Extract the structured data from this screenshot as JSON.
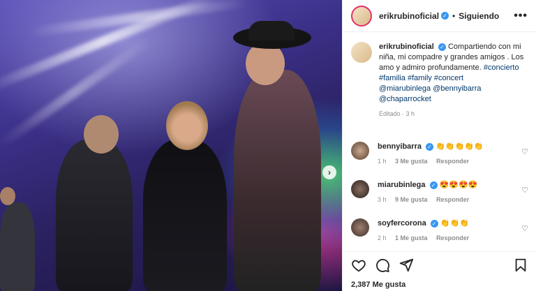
{
  "post": {
    "username": "erikrubinoficial",
    "separator": "•",
    "follow_status": "Siguiendo",
    "more": "•••"
  },
  "caption": {
    "username": "erikrubinoficial",
    "text": "Compartiendo con mi niña, mi compadre y grandes amigos . Los amo y admiro profundamente.",
    "hashtags": [
      "#concierto",
      "#familia",
      "#family",
      "#concert"
    ],
    "mentions": [
      "@miarubinlega",
      "@bennyibarra",
      "@chaparrocket"
    ],
    "edited": "Editado · 3 h"
  },
  "comments": [
    {
      "user": "bennyibarra",
      "emojis": "👏👏👏👏👏",
      "time": "1 h",
      "likes": "3 Me gusta",
      "reply": "Responder"
    },
    {
      "user": "miarubinlega",
      "emojis": "😍😍😍😍",
      "time": "3 h",
      "likes": "9 Me gusta",
      "reply": "Responder"
    },
    {
      "user": "soyfercorona",
      "emojis": "👏👏👏",
      "time": "2 h",
      "likes": "1 Me gusta",
      "reply": "Responder"
    }
  ],
  "likes_count": "2,387 Me gusta",
  "icons": {
    "next": "chevron-right-icon",
    "like": "heart-icon",
    "comment": "comment-icon",
    "share": "share-icon",
    "save": "bookmark-icon",
    "verified": "verified-icon"
  },
  "colors": {
    "verified": "#3897f0",
    "link": "#00376b",
    "meta": "#8e8e8e"
  }
}
